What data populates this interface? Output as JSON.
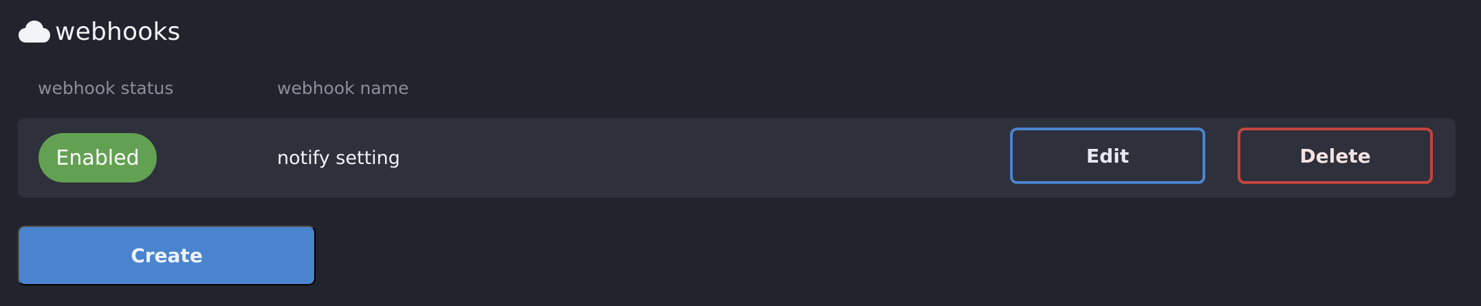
{
  "header": {
    "icon": "cloud-icon",
    "title": "webhooks"
  },
  "table": {
    "columns": [
      "webhook status",
      "webhook name"
    ],
    "rows": [
      {
        "status": "Enabled",
        "status_color": "#63a152",
        "name": "notify setting",
        "edit_label": "Edit",
        "delete_label": "Delete"
      }
    ]
  },
  "actions": {
    "create_label": "Create"
  },
  "colors": {
    "background": "#21242d",
    "row_background": "#2e313b",
    "accent_blue": "#4a84cf",
    "danger_red": "#c4453f",
    "success_green": "#63a152"
  }
}
